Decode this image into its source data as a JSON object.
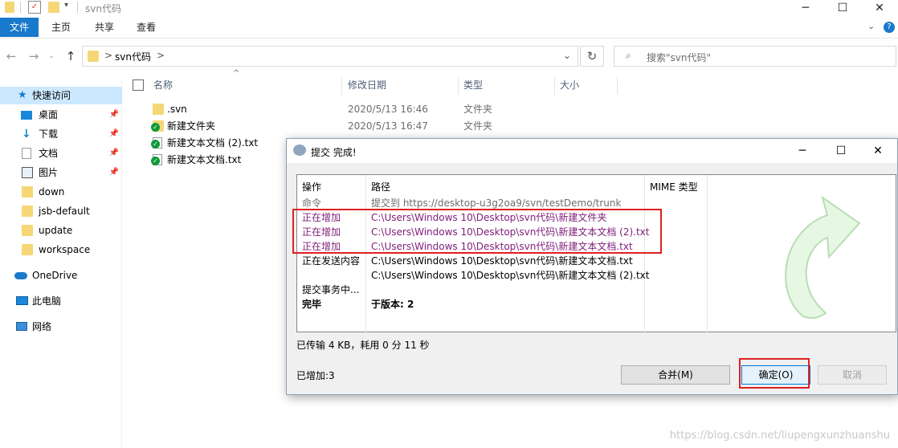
{
  "window": {
    "title": "svn代码"
  },
  "ribbon": {
    "tabs": [
      "文件",
      "主页",
      "共享",
      "查看"
    ]
  },
  "address": {
    "crumb_sep": ">",
    "path": "svn代码",
    "chevron": ">"
  },
  "search": {
    "placeholder": "搜索\"svn代码\""
  },
  "leftnav": {
    "quick_access": "快速访问",
    "items": [
      {
        "label": "桌面",
        "pinned": true,
        "icon": "desktop-icon"
      },
      {
        "label": "下载",
        "pinned": true,
        "icon": "download-icon"
      },
      {
        "label": "文档",
        "pinned": true,
        "icon": "document-icon"
      },
      {
        "label": "图片",
        "pinned": true,
        "icon": "picture-icon"
      },
      {
        "label": "down",
        "pinned": false,
        "icon": "folder-icon"
      },
      {
        "label": "jsb-default",
        "pinned": false,
        "icon": "folder-icon"
      },
      {
        "label": "update",
        "pinned": false,
        "icon": "folder-icon"
      },
      {
        "label": "workspace",
        "pinned": false,
        "icon": "folder-icon"
      }
    ],
    "onedrive": "OneDrive",
    "thispc": "此电脑",
    "network": "网络"
  },
  "filelist": {
    "columns": {
      "name": "名称",
      "date": "修改日期",
      "type": "类型",
      "size": "大小"
    },
    "rows": [
      {
        "name": ".svn",
        "date": "2020/5/13 16:46",
        "type": "文件夹"
      },
      {
        "name": "新建文件夹",
        "date": "2020/5/13 16:47",
        "type": "文件夹"
      },
      {
        "name": "新建文本文档 (2).txt",
        "date": "",
        "type": ""
      },
      {
        "name": "新建文本文档.txt",
        "date": "",
        "type": ""
      }
    ]
  },
  "dialog": {
    "title": "提交 完成!",
    "columns": {
      "action": "操作",
      "path": "路径",
      "mime": "MIME 类型"
    },
    "log": [
      {
        "action": "命令",
        "path": "提交到 https://desktop-u3g2oa9/svn/testDemo/trunk",
        "style": "gray"
      },
      {
        "action": "正在增加",
        "path": "C:\\Users\\Windows 10\\Desktop\\svn代码\\新建文件夹",
        "style": "purple"
      },
      {
        "action": "正在增加",
        "path": "C:\\Users\\Windows 10\\Desktop\\svn代码\\新建文本文档 (2).txt",
        "style": "purple"
      },
      {
        "action": "正在增加",
        "path": "C:\\Users\\Windows 10\\Desktop\\svn代码\\新建文本文档.txt",
        "style": "purple"
      },
      {
        "action": "正在发送内容",
        "path": "C:\\Users\\Windows 10\\Desktop\\svn代码\\新建文本文档.txt",
        "style": "normal"
      },
      {
        "action": "",
        "path": "C:\\Users\\Windows 10\\Desktop\\svn代码\\新建文本文档 (2).txt",
        "style": "normal"
      },
      {
        "action": "提交事务中...",
        "path": "",
        "style": "normal"
      },
      {
        "action": "完毕",
        "path": "于版本: 2",
        "style": "bold"
      }
    ],
    "transfer": "已传输 4 KB，耗用 0 分 11 秒",
    "added": "已增加:3",
    "buttons": {
      "merge": "合并(M)",
      "ok": "确定(O)",
      "cancel": "取消"
    }
  },
  "watermark": "https://blog.csdn.net/liupengxunzhuanshu",
  "colors": {
    "accent": "#1979ca",
    "highlight": "#e02020",
    "purple": "#80207a",
    "svn_green": "#0f9a3a"
  }
}
